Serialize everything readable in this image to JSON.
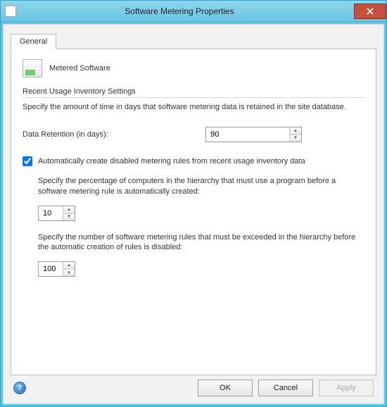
{
  "window": {
    "title": "Software Metering Properties"
  },
  "tabs": {
    "general": "General"
  },
  "header": {
    "title": "Metered Software"
  },
  "group": {
    "title": "Recent Usage Inventory Settings",
    "description": "Specify the amount of time in days that software metering data is retained in the site database."
  },
  "retention": {
    "label": "Data Retention (in days):",
    "value": "90"
  },
  "autoRules": {
    "checked": true,
    "label": "Automatically create disabled metering rules from recent usage inventory data",
    "percentDesc": "Specify the percentage of computers in the hierarchy that must use a program before a software metering rule is automatically created:",
    "percentValue": "10",
    "maxRulesDesc": "Specify the number of software metering rules that must be exceeded in the hierarchy before the automatic creation of rules is disabled:",
    "maxRulesValue": "100"
  },
  "buttons": {
    "ok": "OK",
    "cancel": "Cancel",
    "apply": "Apply"
  }
}
